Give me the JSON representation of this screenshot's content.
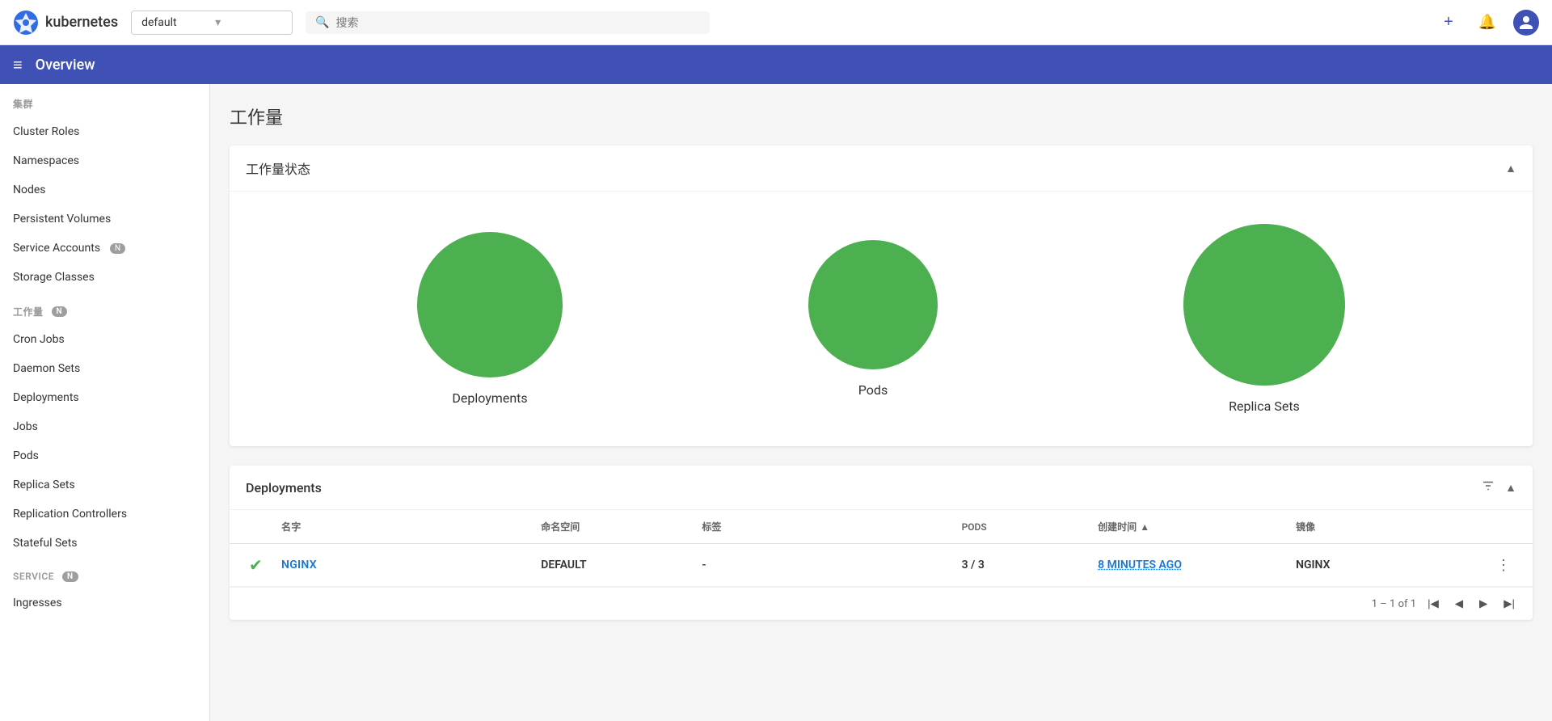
{
  "topbar": {
    "logo_text": "kubernetes",
    "namespace": "default",
    "namespace_placeholder": "default",
    "search_placeholder": "搜索",
    "add_label": "+",
    "notification_label": "🔔",
    "avatar_label": "👤"
  },
  "subheader": {
    "title": "Overview",
    "menu_icon": "≡"
  },
  "sidebar": {
    "cluster_section": "集群",
    "items_cluster": [
      {
        "label": "Cluster Roles",
        "badge": ""
      },
      {
        "label": "Namespaces",
        "badge": ""
      },
      {
        "label": "Nodes",
        "badge": ""
      },
      {
        "label": "Persistent Volumes",
        "badge": ""
      },
      {
        "label": "Service Accounts",
        "badge": "N"
      },
      {
        "label": "Storage Classes",
        "badge": ""
      }
    ],
    "workload_section": "工作量",
    "workload_badge": "N",
    "items_workload": [
      {
        "label": "Cron Jobs",
        "badge": ""
      },
      {
        "label": "Daemon Sets",
        "badge": ""
      },
      {
        "label": "Deployments",
        "badge": ""
      },
      {
        "label": "Jobs",
        "badge": ""
      },
      {
        "label": "Pods",
        "badge": ""
      },
      {
        "label": "Replica Sets",
        "badge": ""
      },
      {
        "label": "Replication Controllers",
        "badge": ""
      },
      {
        "label": "Stateful Sets",
        "badge": ""
      }
    ],
    "service_section": "Service",
    "service_badge": "N",
    "items_service": [
      {
        "label": "Ingresses",
        "badge": ""
      }
    ]
  },
  "main": {
    "page_title": "工作量",
    "workload_status_card": {
      "title": "工作量状态",
      "items": [
        {
          "label": "Deployments"
        },
        {
          "label": "Pods"
        },
        {
          "label": "Replica Sets"
        }
      ]
    },
    "deployments_card": {
      "title": "Deployments",
      "columns": {
        "name": "名字",
        "namespace": "命名空间",
        "tags": "标签",
        "pods": "Pods",
        "created": "创建时间",
        "image": "镜像"
      },
      "rows": [
        {
          "status": "ok",
          "name": "nginx",
          "namespace": "default",
          "tags": "-",
          "pods": "3 / 3",
          "created": "8 minutes ago",
          "image": "nginx"
        }
      ],
      "pagination": "1 – 1 of 1"
    }
  }
}
